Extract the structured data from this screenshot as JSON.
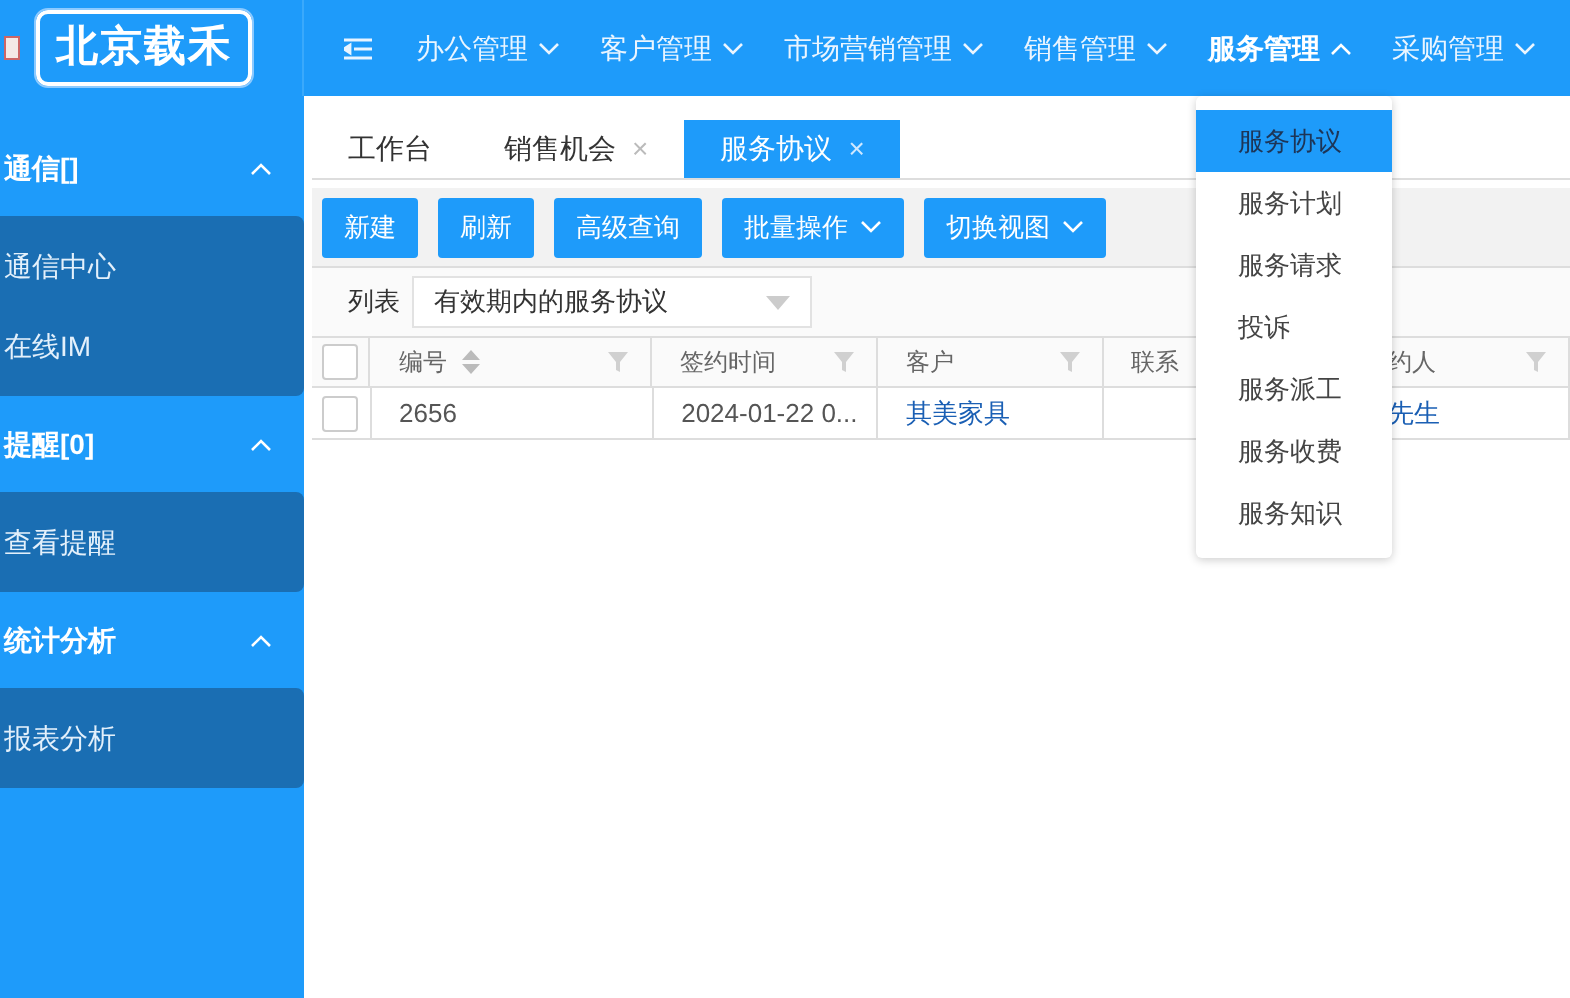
{
  "logo": {
    "text": "北京载禾"
  },
  "top_menu": [
    {
      "label": "办公管理",
      "expanded": false
    },
    {
      "label": "客户管理",
      "expanded": false
    },
    {
      "label": "市场营销管理",
      "expanded": false
    },
    {
      "label": "销售管理",
      "expanded": false
    },
    {
      "label": "服务管理",
      "expanded": true
    },
    {
      "label": "采购管理",
      "expanded": false
    }
  ],
  "dropdown": [
    {
      "label": "服务协议",
      "selected": true
    },
    {
      "label": "服务计划",
      "selected": false
    },
    {
      "label": "服务请求",
      "selected": false
    },
    {
      "label": "投诉",
      "selected": false
    },
    {
      "label": "服务派工",
      "selected": false
    },
    {
      "label": "服务收费",
      "selected": false
    },
    {
      "label": "服务知识",
      "selected": false
    }
  ],
  "sidebar": [
    {
      "label": "通信[]",
      "expanded": true,
      "children": [
        {
          "label": "通信中心"
        },
        {
          "label": "在线IM"
        }
      ]
    },
    {
      "label": "提醒[0]",
      "expanded": true,
      "children": [
        {
          "label": "查看提醒"
        }
      ]
    },
    {
      "label": "统计分析",
      "expanded": true,
      "children": [
        {
          "label": "报表分析"
        }
      ]
    }
  ],
  "tabs": [
    {
      "label": "工作台",
      "selected": false
    },
    {
      "label": "销售机会",
      "selected": false,
      "close": "×"
    },
    {
      "label": "服务协议",
      "selected": true,
      "close": "×"
    }
  ],
  "toolbar": [
    {
      "label": "新建",
      "menu": false
    },
    {
      "label": "刷新",
      "menu": false
    },
    {
      "label": "高级查询",
      "menu": false
    },
    {
      "label": "批量操作",
      "menu": true
    },
    {
      "label": "切换视图",
      "menu": true
    }
  ],
  "filter": {
    "label": "列表",
    "value": "有效期内的服务协议"
  },
  "table": {
    "columns": [
      {
        "label": "编号",
        "sortable": true
      },
      {
        "label": "签约时间",
        "sortable": false
      },
      {
        "label": "客户",
        "sortable": false
      },
      {
        "label": "联系",
        "sortable": false
      },
      {
        "label": "约人",
        "sortable": false
      }
    ],
    "all_checked": false,
    "rows": [
      {
        "checked": false,
        "number": "2656",
        "signed_at": "2024-01-22 0...",
        "customer": "其美家具",
        "signer": "先生"
      }
    ]
  }
}
